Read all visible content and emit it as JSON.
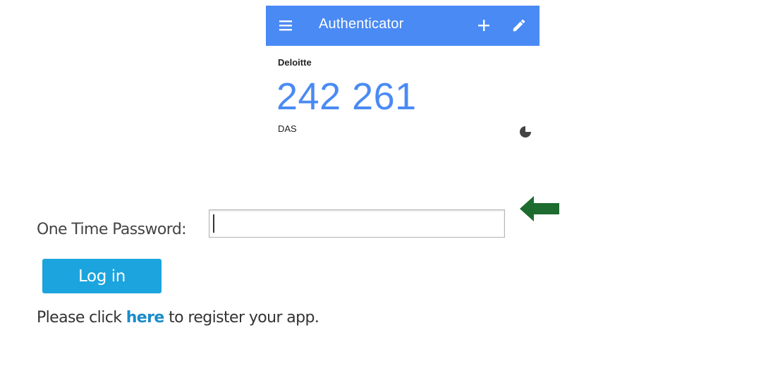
{
  "authenticator": {
    "title": "Authenticator",
    "menu_icon": "menu-icon",
    "add_icon": "plus-icon",
    "edit_icon": "pencil-icon",
    "accent_color": "#4a8af4",
    "account": {
      "issuer": "Deloitte",
      "code": "242 261",
      "name": "DAS",
      "timer_icon": "countdown-timer-icon"
    }
  },
  "login_form": {
    "otp_label": "One Time Password:",
    "otp_value": "",
    "otp_placeholder": "",
    "login_button": "Log in",
    "register_prefix": "Please click ",
    "register_link": "here",
    "register_suffix": " to register your app.",
    "button_color": "#1ba4dd",
    "link_color": "#1a8cc8",
    "pointer_arrow_icon": "left-arrow-icon",
    "pointer_arrow_color": "#1e6b2f"
  }
}
